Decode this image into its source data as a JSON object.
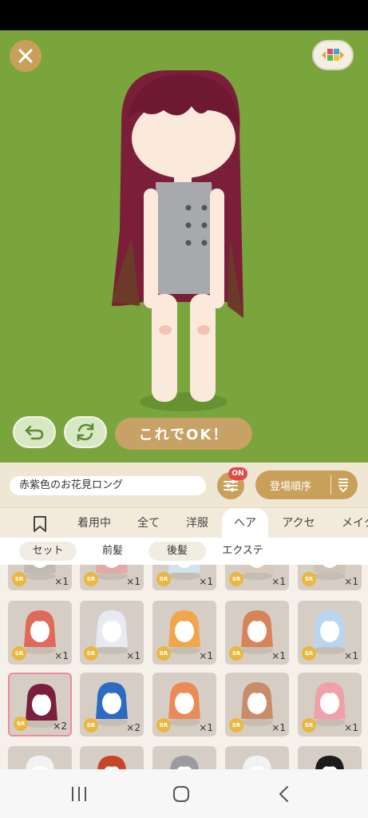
{
  "stage": {
    "ok_label": "これでOK！"
  },
  "toolbar": {
    "item_name": "赤紫色のお花見ロング",
    "filter_badge": "ON",
    "sort_label": "登場順序"
  },
  "tabs": [
    "着用中",
    "全て",
    "洋服",
    "ヘア",
    "アクセ",
    "メイク"
  ],
  "active_tab": "ヘア",
  "subtabs": [
    "セット",
    "前髪",
    "後髪",
    "エクステ"
  ],
  "grid": {
    "rarity": "SR",
    "rows": [
      {
        "counts": [
          "×1",
          "×1",
          "×1",
          "×1",
          "×1"
        ]
      },
      {
        "counts": [
          "×1",
          "×1",
          "×1",
          "×1",
          "×1"
        ]
      },
      {
        "counts": [
          "×2",
          "×2",
          "×1",
          "×1",
          "×1"
        ]
      },
      {
        "counts": [
          "",
          "",
          "",
          "",
          ""
        ]
      }
    ],
    "hair_colors": [
      [
        "#bfbab3",
        "#e6a7a8",
        "#cfe4ef",
        "#d7c9bd",
        "#cfc3b8"
      ],
      [
        "#e0695d",
        "#e8eaf2",
        "#f2a64b",
        "#d8835a",
        "#b8d6ef"
      ],
      [
        "#7a1f3e",
        "#2b6bc2",
        "#ea8b55",
        "#c98c6a",
        "#f0a0a8"
      ],
      [
        "#f2f2f2",
        "#c8452a",
        "#9a9aa0",
        "#f2f2f2",
        "#1c1c1c"
      ]
    ]
  },
  "colors": {
    "stage_bg": "#7aa43c",
    "accent": "#c9a05a",
    "hair": "#7b1e3a"
  }
}
